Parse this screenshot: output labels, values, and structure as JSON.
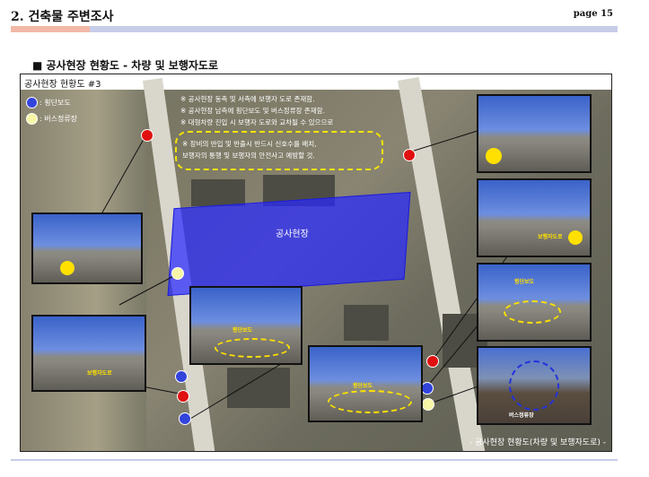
{
  "header": {
    "title": "2. 건축물 주변조사",
    "page": "page 15"
  },
  "section_title": "■ 공사현장 현황도 - 차량 및 보행자도로",
  "figure": {
    "label": "공사현장 현황도 #3",
    "legend": [
      {
        "label": ": 횡단보도",
        "color": "#3344dd"
      },
      {
        "label": ": 버스정류장",
        "color": "#f6f6a6"
      }
    ],
    "notes": [
      "※ 공사현장 동측 및 서측에 보행자 도로 존재함.",
      "※ 공사현장 남측에 횡단보도 및 버스정류장 존재함.",
      "※ 대형차량 진입 시 보행자 도로와 교차될 수 있으므로"
    ],
    "highlight_notes": [
      "※ 장비의 반입 및 반출시 반드시 신호수를 배치,",
      "보행자의 통행 및 보행자의 안전사고 예방할 것."
    ],
    "site_label": "공사현장",
    "photo_tags": {
      "mid_left": "횡단보도",
      "bottom_left": "보행자도로",
      "bottom_center": "횡단보도",
      "right_2": "보행자도로",
      "right_3": "횡단보도",
      "right_4": "버스정류장"
    },
    "caption": "- 공사현장 현황도(차량 및 보행자도로) -"
  }
}
